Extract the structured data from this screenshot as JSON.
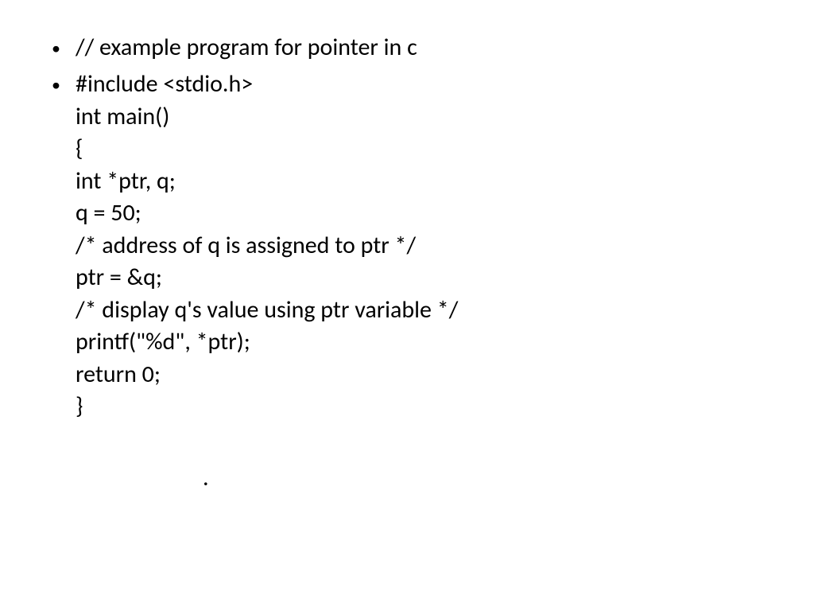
{
  "bullets": [
    {
      "marker": "•",
      "lines": [
        "// example program for pointer in c"
      ]
    },
    {
      "marker": "•",
      "lines": [
        "#include <stdio.h>",
        "int main()",
        "{",
        "int *ptr, q;",
        "q = 50;",
        "/* address of q is assigned to ptr */",
        "ptr = &q;",
        "/* display q's value using ptr variable */",
        "printf(\"%d\", *ptr);",
        "return 0;",
        "}"
      ]
    }
  ],
  "trailing_dot": "."
}
